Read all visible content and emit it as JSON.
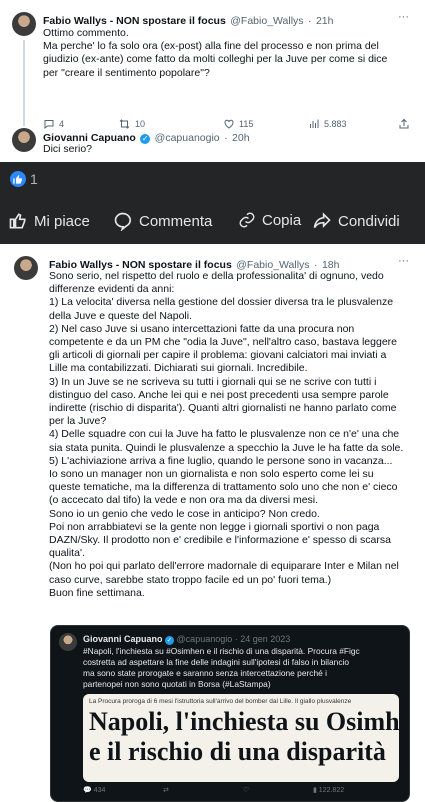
{
  "tweet1": {
    "name": "Fabio Wallys - NON spostare il focus",
    "handle": "@Fabio_Wallys",
    "time": "21h",
    "lines": [
      "Ottimo commento.",
      "Ma perche' lo fa solo ora (ex-post) alla fine del processo e non prima del",
      "giudizio (ex-ante) come fatto da molti colleghi per la Juve per come si dice",
      "per \"creare il sentimento popolare\"?"
    ],
    "replies": "4",
    "retweets": "10",
    "likes": "115",
    "views": "5.883"
  },
  "tweet2": {
    "name": "Giovanni Capuano",
    "handle": "@capuanogio",
    "time": "20h",
    "text": "Dici serio?"
  },
  "facebook": {
    "like_count": "1",
    "like_label": "Mi piace",
    "comment_label": "Commenta",
    "copy_label": "Copia",
    "share_label": "Condividi",
    "accent": "#2d88ff",
    "bar_color": "#242526"
  },
  "tweet3": {
    "name": "Fabio Wallys - NON spostare il focus",
    "handle": "@Fabio_Wallys",
    "time": "18h",
    "lines": [
      "Sono serio, nel rispetto del ruolo e della professionalita' di ognuno, vedo",
      "differenze evidenti da anni:",
      "1) La velocita' diversa nella gestione del dossier diversa tra le plusvalenze",
      "della Juve e queste del Napoli.",
      "2) Nel caso Juve si usano intercettazioni fatte da una procura non",
      "competente e da un PM che \"odia la Juve\", nell'altro caso, bastava leggere",
      "gli articoli di giornali per capire il problema: giovani calciatori mai inviati a",
      "Lille ma contabilizzati. Dichiarati sui giornali. Incredibile.",
      "3) In un Juve se ne scriveva su tutti i giornali qui se ne scrive con tutti i",
      "distinguo del caso. Anche lei qui e nei post precedenti usa sempre parole",
      "indirette (rischio di disparita'). Quanti altri giornalisti ne hanno parlato come",
      "per la Juve?",
      "4) Delle squadre con cui la Juve ha fatto le plusvalenze non ce n'e' una che",
      "sia stata punita. Quindi le plusvalenze a specchio la Juve le ha fatte da sole.",
      "5) L'achiviazione arriva a fine luglio, quando le persone sono in vacanza...",
      "Io sono un manager non un giornalista e non solo esperto come lei su",
      "queste tematiche, ma la differenza di trattamento solo uno che non e' cieco",
      "(o accecato dal tifo) la vede e non ora ma da diversi mesi.",
      "Sono io un genio che vedo le cose in anticipo? Non credo.",
      "Poi non arrabbiatevi se la gente non legge i giornali sportivi o non paga",
      "DAZN/Sky. Il prodotto non e' credibile e l'informazione e' spesso di scarsa",
      "qualita'.",
      "(Non ho poi qui parlato dell'errore madornale di equiparare Inter e Milan nel",
      "caso curve, sarebbe stato troppo facile ed un po' fuori tema.)",
      "Buon fine settimana."
    ]
  },
  "quoted": {
    "name": "Giovanni Capuano",
    "handle": "@capuanogio",
    "date": "24 gen 2023",
    "line1": "#Napoli, l'inchiesta su #Osimhen e il rischio di una disparità. Procura #Figc",
    "line2": "costretta ad aspettare la fine delle indagini sull'ipotesi di falso in bilancio",
    "line3": "ma sono state prorogate e saranno senza intercettazione perché i",
    "line4": "partenopei non sono quotati in Borsa (#LaStampa)",
    "kicker": "La Procura proroga di 6 mesi l'istruttoria sull'arrivo del bomber dal Lille. Il giallo plusvalenze",
    "headline1": "Napoli, l'inchiesta su Osimhen",
    "headline2": "e il rischio di una disparità",
    "replies": "434",
    "views": "122.822"
  }
}
